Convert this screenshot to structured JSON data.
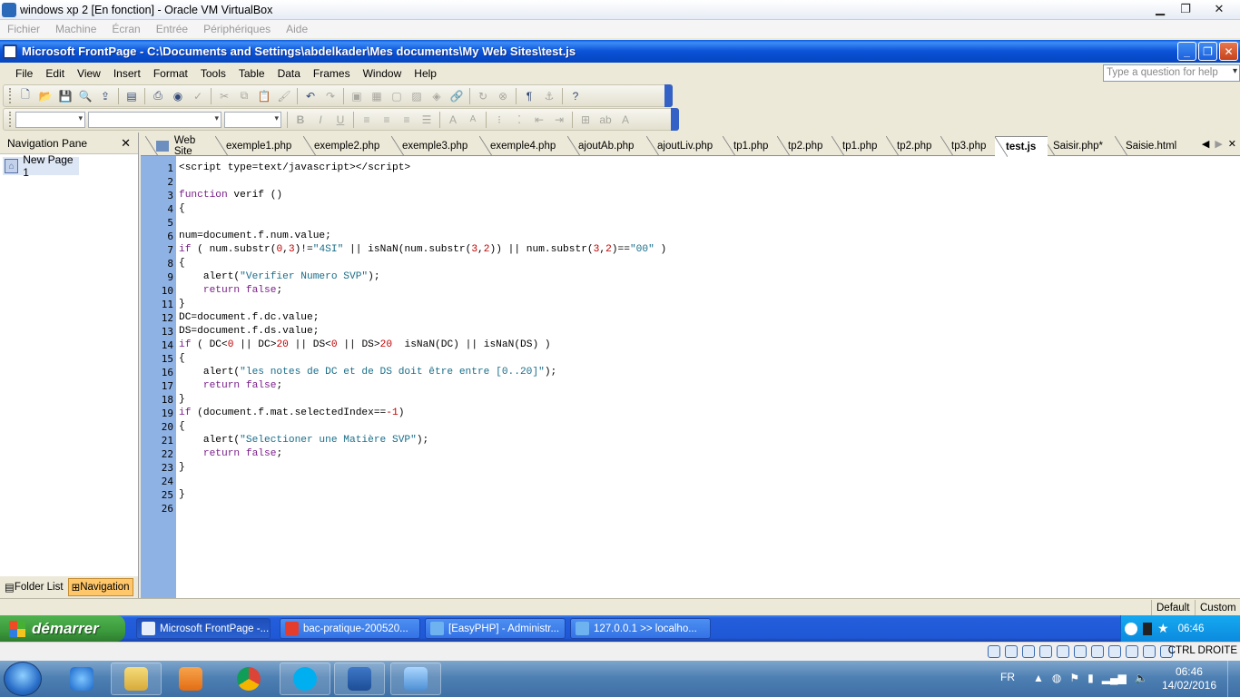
{
  "host": {
    "title": "windows xp 2 [En fonction] - Oracle VM VirtualBox",
    "menu": [
      "Fichier",
      "Machine",
      "Écran",
      "Entrée",
      "Périphériques",
      "Aide"
    ],
    "status_hostkey": "CTRL DROITE"
  },
  "frontpage": {
    "title": "Microsoft FrontPage - C:\\Documents and Settings\\abdelkader\\Mes documents\\My Web Sites\\test.js",
    "menu": [
      "File",
      "Edit",
      "View",
      "Insert",
      "Format",
      "Tools",
      "Table",
      "Data",
      "Frames",
      "Window",
      "Help"
    ],
    "help_placeholder": "Type a question for help",
    "nav_pane": {
      "title": "Navigation Pane",
      "page": "New Page 1",
      "folder_list": "Folder List",
      "navigation": "Navigation"
    },
    "tabs": [
      "Web Site",
      "exemple1.php",
      "exemple2.php",
      "exemple3.php",
      "exemple4.php",
      "ajoutAb.php",
      "ajoutLiv.php",
      "tp1.php",
      "tp2.php",
      "tp1.php",
      "tp2.php",
      "tp3.php",
      "test.js",
      "Saisir.php*",
      "Saisie.html"
    ],
    "active_tab": "test.js",
    "status": {
      "default": "Default",
      "custom": "Custom"
    }
  },
  "code_lines": [
    "<script type=text/javascript></script>",
    "",
    "function verif ()",
    "{",
    "",
    "num=document.f.num.value;",
    "if ( num.substr(0,3)!=\"4SI\" || isNaN(num.substr(3,2)) || num.substr(3,2)==\"00\" )",
    "{",
    "    alert(\"Verifier Numero SVP\");",
    "    return false;",
    "}",
    "DC=document.f.dc.value;",
    "DS=document.f.ds.value;",
    "if ( DC<0 || DC>20 || DS<0 || DS>20  isNaN(DC) || isNaN(DS) )",
    "{",
    "    alert(\"les notes de DC et de DS doit être entre [0..20]\");",
    "    return false;",
    "}",
    "if (document.f.mat.selectedIndex==-1)",
    "{",
    "    alert(\"Selectioner une Matière SVP\");",
    "    return false;",
    "}",
    "",
    "}",
    ""
  ],
  "xp_taskbar": {
    "start": "démarrer",
    "tasks": [
      "Microsoft FrontPage -...",
      "bac-pratique-200520...",
      "[EasyPHP] - Administr...",
      "127.0.0.1 >> localho..."
    ],
    "lang": "FR",
    "time": "06:46"
  },
  "win7_taskbar": {
    "lang": "FR",
    "time": "06:46",
    "date": "14/02/2016"
  }
}
